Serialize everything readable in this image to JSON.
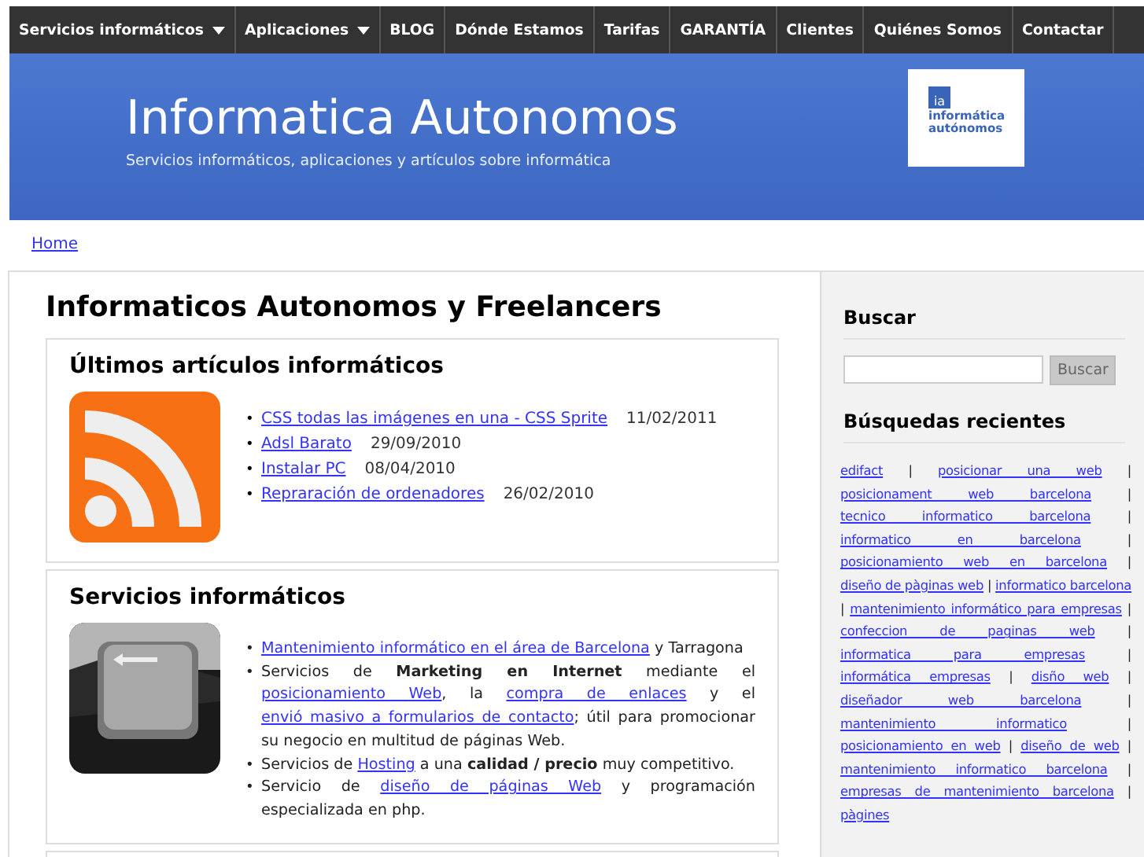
{
  "nav": [
    {
      "label": "Servicios informáticos",
      "has_menu": true
    },
    {
      "label": "Aplicaciones",
      "has_menu": true
    },
    {
      "label": "BLOG",
      "has_menu": false
    },
    {
      "label": "Dónde Estamos",
      "has_menu": false
    },
    {
      "label": "Tarifas",
      "has_menu": false
    },
    {
      "label": "GARANTÍA",
      "has_menu": false
    },
    {
      "label": "Clientes",
      "has_menu": false
    },
    {
      "label": "Quiénes Somos",
      "has_menu": false
    },
    {
      "label": "Contactar",
      "has_menu": false
    }
  ],
  "header": {
    "title": "Informatica Autonomos",
    "tagline": "Servicios informáticos, aplicaciones y artículos sobre informática",
    "logo": {
      "mark": "ia",
      "lines": [
        "informática",
        "autónomos"
      ]
    }
  },
  "breadcrumb": "Home",
  "page_title": "Informaticos Autonomos y Freelancers",
  "bullet": "•",
  "articles": {
    "title": "Últimos artículos informáticos",
    "items": [
      {
        "link": "CSS todas las imágenes en una - CSS Sprite",
        "date": "11/02/2011"
      },
      {
        "link": "Adsl Barato",
        "date": "29/09/2010"
      },
      {
        "link": "Instalar PC",
        "date": "08/04/2010"
      },
      {
        "link": "Repraración de ordenadores",
        "date": "26/02/2010"
      }
    ]
  },
  "services": {
    "title": "Servicios informáticos",
    "items": [
      [
        {
          "kind": "link",
          "text": "Mantenimiento informático en el área de Barcelona"
        },
        {
          "kind": "text",
          "text": " y Tarragona"
        }
      ],
      [
        {
          "kind": "text",
          "text": "Servicios de "
        },
        {
          "kind": "bold",
          "text": "Marketing en Internet"
        },
        {
          "kind": "text",
          "text": " mediante el "
        },
        {
          "kind": "link",
          "text": "posicionamiento Web"
        },
        {
          "kind": "text",
          "text": ", la "
        },
        {
          "kind": "link",
          "text": "compra de enlaces"
        },
        {
          "kind": "text",
          "text": " y el "
        },
        {
          "kind": "link",
          "text": "envió masivo a formularios de contacto"
        },
        {
          "kind": "text",
          "text": "; útil para promocionar su negocio en multitud de páginas Web."
        }
      ],
      [
        {
          "kind": "text",
          "text": "Servicios de "
        },
        {
          "kind": "link",
          "text": "Hosting"
        },
        {
          "kind": "text",
          "text": " a una "
        },
        {
          "kind": "bold",
          "text": "calidad / precio"
        },
        {
          "kind": "text",
          "text": " muy competitivo."
        }
      ],
      [
        {
          "kind": "text",
          "text": "Servicio de "
        },
        {
          "kind": "link",
          "text": "diseño de páginas Web"
        },
        {
          "kind": "text",
          "text": " y programación especializada en php."
        }
      ]
    ]
  },
  "sidebar": {
    "search_title": "Buscar",
    "search_button": "Buscar",
    "recent_title": "Búsquedas recientes",
    "recent": [
      "edifact",
      "posicionar una web",
      "posicionament web barcelona",
      "tecnico informatico barcelona",
      "informatico en barcelona",
      "posicionamiento web en barcelona",
      "diseño de pàginas web",
      "informatico barcelona",
      "mantenimiento informático para empresas",
      "confeccion de paginas web",
      "informatica para empresas",
      "informática empresas",
      "disño web",
      "diseñador web barcelona",
      "mantenimiento informatico",
      "posicionamiento en web",
      "diseño de web",
      "mantenimiento informatico barcelona",
      "empresas de mantenimiento barcelona",
      "pàgines"
    ],
    "separator": "|"
  }
}
